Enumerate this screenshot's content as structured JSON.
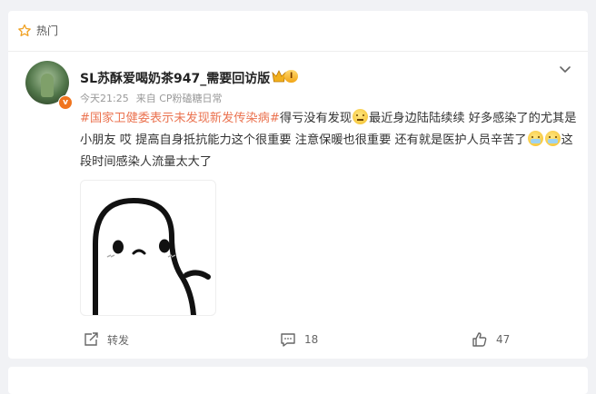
{
  "section": {
    "hot_label": "热门"
  },
  "post": {
    "username": "SL苏酥爱喝奶茶947_需要回访版",
    "level_badge": "I",
    "time": "今天21:25",
    "source": "来自 CP粉磕糖日常",
    "verified_badge": "v",
    "topic": "#国家卫健委表示未发现新发传染病#",
    "text_1": "得亏没有发现",
    "text_2": "最近身边陆陆续续 好多感染了的尤其是小朋友 哎 提高自身抵抗能力这个很重要 注意保暖也很重要 还有就是医护人员辛苦了",
    "text_3": "这段时间感染人流量太大了",
    "emojis": [
      "eye-roll-emoji",
      "mask-emoji",
      "mask-emoji"
    ]
  },
  "actions": {
    "repost_label": "转发",
    "comment_count": "18",
    "like_count": "47"
  },
  "colors": {
    "topic": "#eb7350",
    "badge": "#f0741e"
  }
}
